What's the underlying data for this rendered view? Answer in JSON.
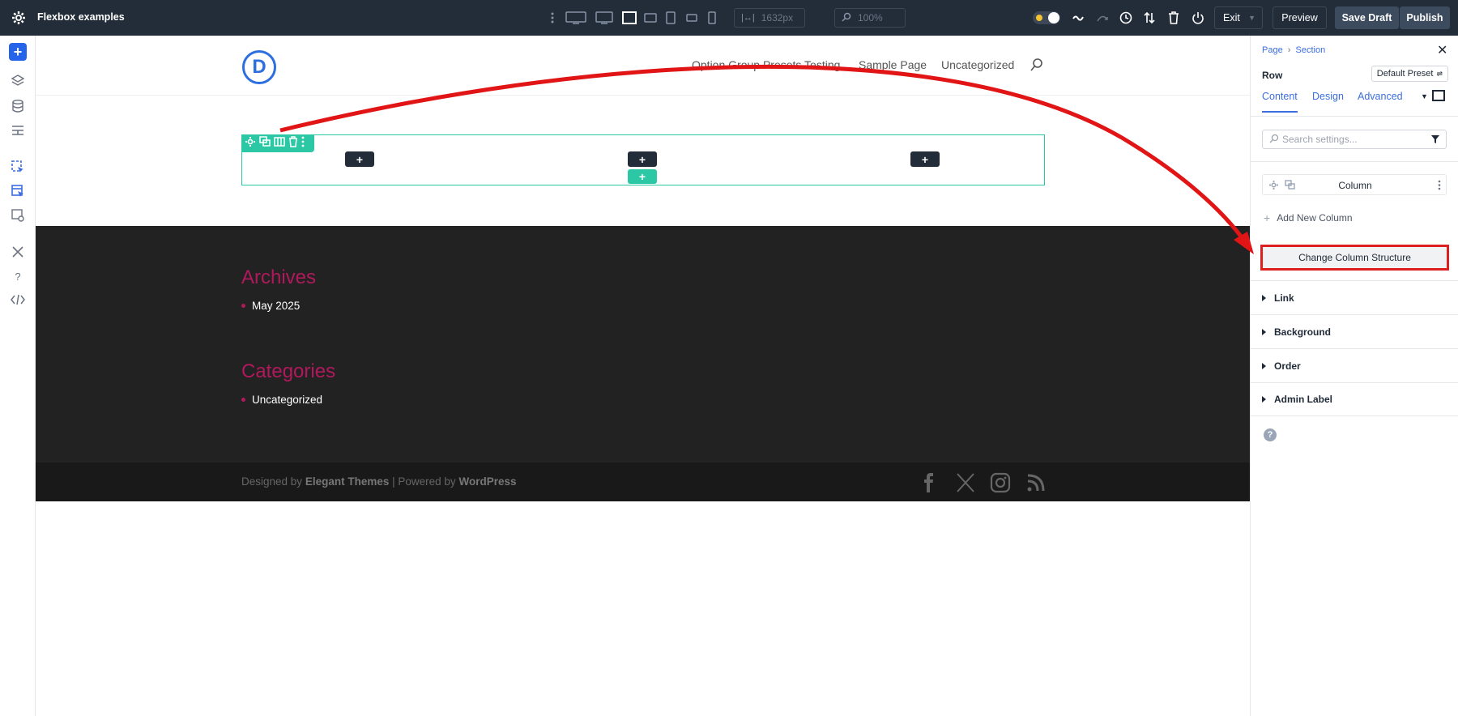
{
  "topbar": {
    "app_title": "Flexbox examples",
    "width_value": "1632px",
    "zoom_value": "100%",
    "exit_label": "Exit",
    "preview_label": "Preview",
    "save_draft_label": "Save Draft",
    "publish_label": "Publish"
  },
  "site": {
    "nav": [
      "Option Group Presets Testing",
      "Sample Page",
      "Uncategorized"
    ],
    "logo_letter": "D",
    "row_add_symbol": "+",
    "footer": {
      "archives_title": "Archives",
      "archives_item": "May 2025",
      "categories_title": "Categories",
      "categories_item": "Uncategorized",
      "credits_prefix": "Designed by",
      "credits_brand": "Elegant Themes",
      "credits_mid": "| Powered by",
      "credits_wp": "WordPress"
    }
  },
  "panel": {
    "breadcrumb_page": "Page",
    "breadcrumb_section": "Section",
    "heading": "Row",
    "preset_label": "Default Preset",
    "tabs": [
      "Content",
      "Design",
      "Advanced"
    ],
    "search_placeholder": "Search settings...",
    "column_label": "Column",
    "add_column_label": "Add New Column",
    "change_structure_label": "Change Column Structure",
    "sections": [
      "Link",
      "Background",
      "Order",
      "Admin Label"
    ],
    "help_symbol": "?"
  },
  "colors": {
    "accent": "#2cc8a5",
    "topbar_bg": "#232d3a",
    "link_blue": "#3b6ee0",
    "highlight_red": "#dd1f1f",
    "widget_title": "#b1195c"
  }
}
